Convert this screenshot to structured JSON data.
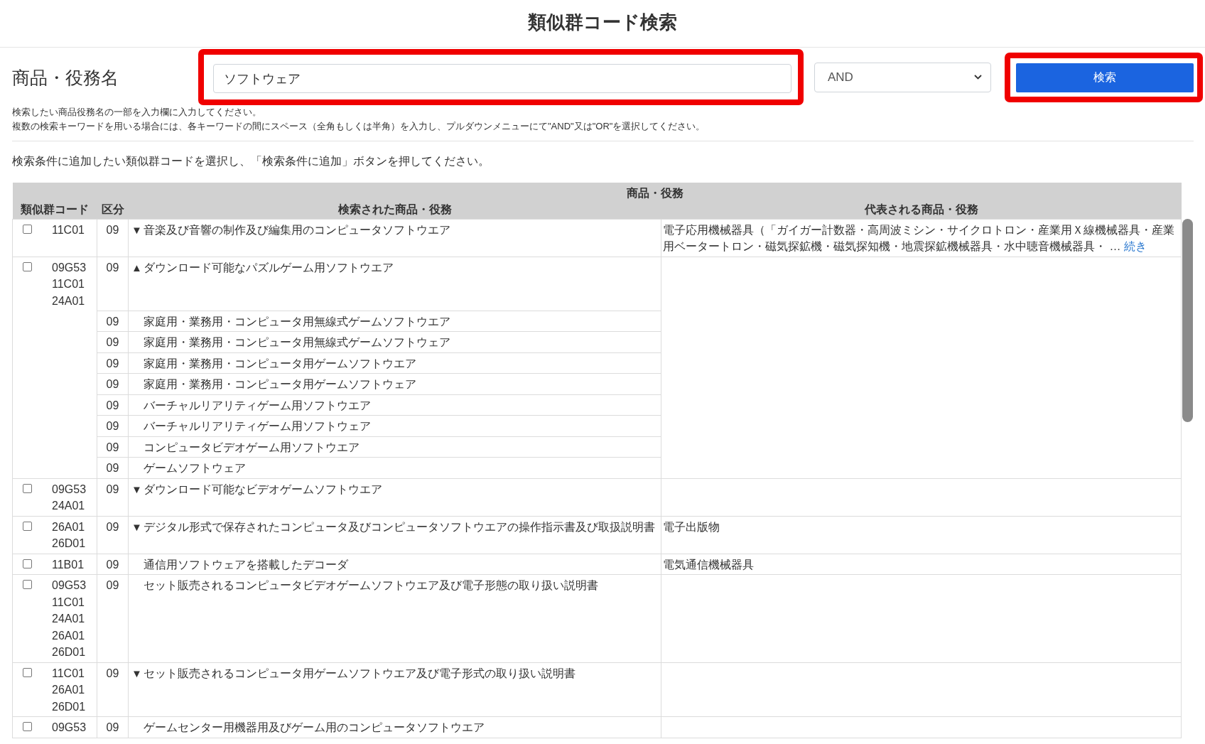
{
  "header": {
    "title": "類似群コード検索"
  },
  "search_form": {
    "label": "商品・役務名",
    "query": {
      "value": "ソフトウェア",
      "highlighted": true
    },
    "operator": {
      "value": "AND"
    },
    "search_button": {
      "label": "検索",
      "highlighted": true
    },
    "help": [
      "検索したい商品役務名の一部を入力欄に入力してください。",
      "複数の検索キーワードを用いる場合には、各キーワードの間にスペース（全角もしくは半角）を入力し、プルダウンメニューにて\"AND\"又は\"OR\"を選択してください。"
    ]
  },
  "instruction": "検索条件に追加したい類似群コードを選択し、「検索条件に追加」ボタンを押してください。",
  "table": {
    "group_header": "商品・役務",
    "columns": [
      "類似群コード",
      "区分",
      "検索された商品・役務",
      "代表される商品・役務"
    ],
    "rows": [
      {
        "checked": false,
        "codes": [
          "11C01"
        ],
        "class": "09",
        "toggle": "▼",
        "goods": "音楽及び音響の制作及び編集用のコンピュータソフトウエア",
        "representative": "電子応用機械器具（「ガイガー計数器・高周波ミシン・サイクロトロン・産業用Ｘ線機械器具・産業用ベータートロン・磁気探鉱機・磁気探知機・地震探鉱機械器具・水中聴音機械器具・ …",
        "more_link": "続き"
      },
      {
        "checked": false,
        "codes": [
          "09G53",
          "11C01",
          "24A01"
        ],
        "class": "09",
        "toggle": "▲",
        "goods": "ダウンロード可能なパズルゲーム用ソフトウエア",
        "children": [
          {
            "class": "09",
            "goods": "家庭用・業務用・コンピュータ用無線式ゲームソフトウエア"
          },
          {
            "class": "09",
            "goods": "家庭用・業務用・コンピュータ用無線式ゲームソフトウェア"
          },
          {
            "class": "09",
            "goods": "家庭用・業務用・コンピュータ用ゲームソフトウエア"
          },
          {
            "class": "09",
            "goods": "家庭用・業務用・コンピュータ用ゲームソフトウェア"
          },
          {
            "class": "09",
            "goods": "バーチャルリアリティゲーム用ソフトウエア"
          },
          {
            "class": "09",
            "goods": "バーチャルリアリティゲーム用ソフトウェア"
          },
          {
            "class": "09",
            "goods": "コンピュータビデオゲーム用ソフトウエア"
          },
          {
            "class": "09",
            "goods": "ゲームソフトウェア"
          }
        ]
      },
      {
        "checked": false,
        "codes": [
          "09G53",
          "24A01"
        ],
        "class": "09",
        "toggle": "▼",
        "goods": "ダウンロード可能なビデオゲームソフトウエア"
      },
      {
        "checked": false,
        "codes": [
          "26A01",
          "26D01"
        ],
        "class": "09",
        "toggle": "▼",
        "goods": "デジタル形式で保存されたコンピュータ及びコンピュータソフトウエアの操作指示書及び取扱説明書",
        "representative": "電子出版物"
      },
      {
        "checked": false,
        "codes": [
          "11B01"
        ],
        "class": "09",
        "goods": "通信用ソフトウェアを搭載したデコーダ",
        "representative": "電気通信機械器具"
      },
      {
        "checked": false,
        "codes": [
          "09G53",
          "11C01",
          "24A01",
          "26A01",
          "26D01"
        ],
        "class": "09",
        "goods": "セット販売されるコンピュータビデオゲームソフトウエア及び電子形態の取り扱い説明書"
      },
      {
        "checked": false,
        "codes": [
          "11C01",
          "26A01",
          "26D01"
        ],
        "class": "09",
        "toggle": "▼",
        "goods": "セット販売されるコンピュータ用ゲームソフトウエア及び電子形式の取り扱い説明書"
      },
      {
        "checked": false,
        "codes": [
          "09G53"
        ],
        "class": "09",
        "goods": "ゲームセンター用機器用及びゲーム用のコンピュータソフトウエア"
      }
    ]
  }
}
